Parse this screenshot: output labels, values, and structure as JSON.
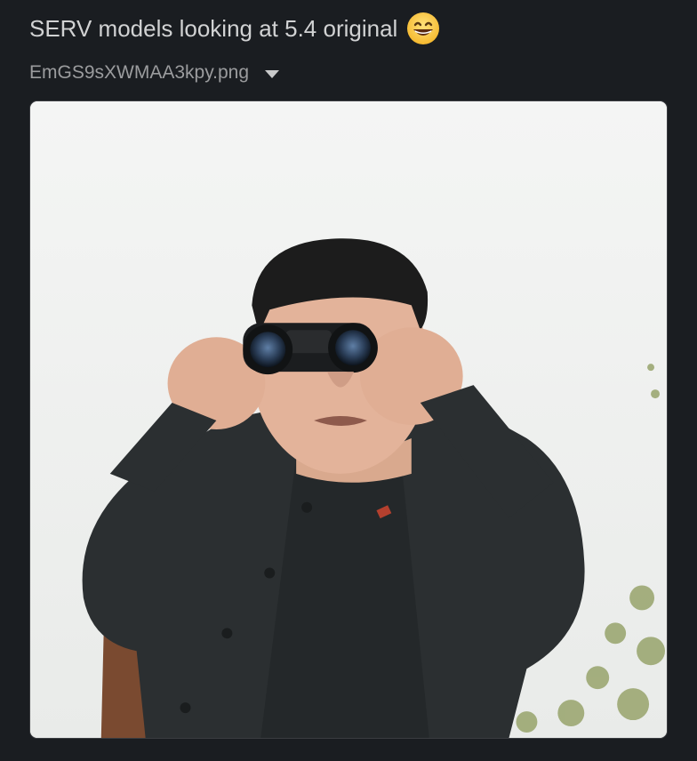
{
  "message": {
    "text": "SERV models looking at 5.4 original",
    "emoji": "grinning-face-with-smiling-eyes"
  },
  "attachment": {
    "filename": "EmGS9sXWMAA3kpy.png",
    "toggle_icon": "caret-down-icon",
    "image_description_icon": "photo-icon"
  },
  "colors": {
    "background": "#1a1d21",
    "text_primary": "#d1d2d3",
    "text_secondary": "#9b9c9e",
    "image_border": "#3b3d41"
  }
}
